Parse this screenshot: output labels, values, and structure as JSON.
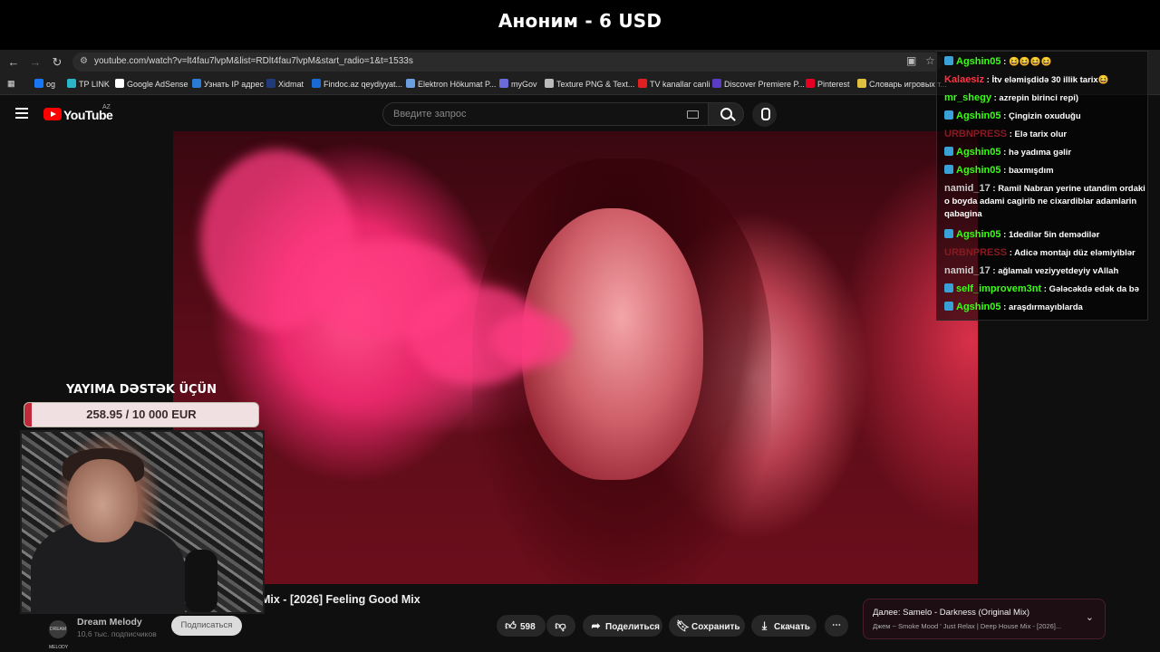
{
  "stream": {
    "title": "Аноним - 6 USD"
  },
  "browser": {
    "url": "youtube.com/watch?v=lt4fau7lvpM&list=RDlt4fau7lvpM&start_radio=1&t=1533s",
    "bookmarks": [
      "og",
      "TP LINK",
      "Google AdSense",
      "Узнать IP адрес",
      "Xidmat",
      "Findoc.az qeydiyyat...",
      "Elektron Hökumat P...",
      "myGov",
      "Texture PNG & Text...",
      "TV kanallar canli",
      "Discover Premiere P...",
      "Pinterest",
      "Словарь игровых т..."
    ],
    "bookmark_colors": [
      "#1877f2",
      "#2bb5c8",
      "#ffffff",
      "#2a7bd4",
      "#203a7a",
      "#1a6ad6",
      "#6aa0e0",
      "#6a6ad8",
      "#bbbbbb",
      "#e02020",
      "#5b3cc4",
      "#e60023",
      "#e0c040"
    ]
  },
  "youtube": {
    "logo_text": "YouTube",
    "region": "AZ",
    "search_placeholder": "Введите запрос",
    "video_title": "Mix - [2026] Feeling Good Mix",
    "channel": {
      "avatar_text": "DREAM MELODY",
      "name": "Dream Melody",
      "subs": "10,6 тыс. подписчиков",
      "subscribe_label": "Подписаться"
    },
    "actions": {
      "likes": "598",
      "share": "Поделиться",
      "save": "Сохранить",
      "download": "Скачать"
    },
    "up_next": {
      "label": "Далее: Samelo - Darkness (Original Mix)",
      "playlist": "Джем ~ Smoke Mood ' Just Relax | Deep House Mix - [2026]..."
    }
  },
  "donation": {
    "title": "YAYIMA DƏSTƏK ÜÇÜN",
    "progress_text": "258.95 / 10 000 EUR",
    "progress_fraction": 0.026
  },
  "chat": [
    {
      "user": "Agshin05",
      "color": "#39ff14",
      "badge": true,
      "msg": "😆😆😆😆"
    },
    {
      "user": "Kalaesiz",
      "color": "#ff3344",
      "badge": false,
      "msg": "İtv eləmişdidə 30 illik tarix😆"
    },
    {
      "user": "mr_shegy",
      "color": "#39ff14",
      "badge": false,
      "msg": "azrepin birinci repi)"
    },
    {
      "user": "Agshin05",
      "color": "#39ff14",
      "badge": true,
      "msg": "Çingizin oxuduğu"
    },
    {
      "user": "URBNPRESS",
      "color": "#8a1a22",
      "badge": false,
      "msg": "Elə tarix olur"
    },
    {
      "user": "Agshin05",
      "color": "#39ff14",
      "badge": true,
      "msg": "hə yadıma gəlir"
    },
    {
      "user": "Agshin05",
      "color": "#39ff14",
      "badge": true,
      "msg": "baxmışdım"
    },
    {
      "user": "namid_17",
      "color": "#cccccc",
      "badge": false,
      "msg": "Ramil Nabran yerine utandim ordaki o boyda adami cagirib ne cixardiblar adamlarin qabagina"
    },
    {
      "user": "Agshin05",
      "color": "#39ff14",
      "badge": true,
      "msg": "1dedilər 5in demədilər"
    },
    {
      "user": "URBNPRESS",
      "color": "#8a1a22",
      "badge": false,
      "msg": "Adicə montajı düz eləmiyiblər"
    },
    {
      "user": "namid_17",
      "color": "#cccccc",
      "badge": false,
      "msg": "ağlamalı veziyyetdeyiy vAllah"
    },
    {
      "user": "self_improvem3nt",
      "color": "#39ff14",
      "badge": true,
      "msg": "Gələcəkdə edək da bə"
    },
    {
      "user": "Agshin05",
      "color": "#39ff14",
      "badge": true,
      "msg": "araşdırmayıblarda"
    }
  ]
}
